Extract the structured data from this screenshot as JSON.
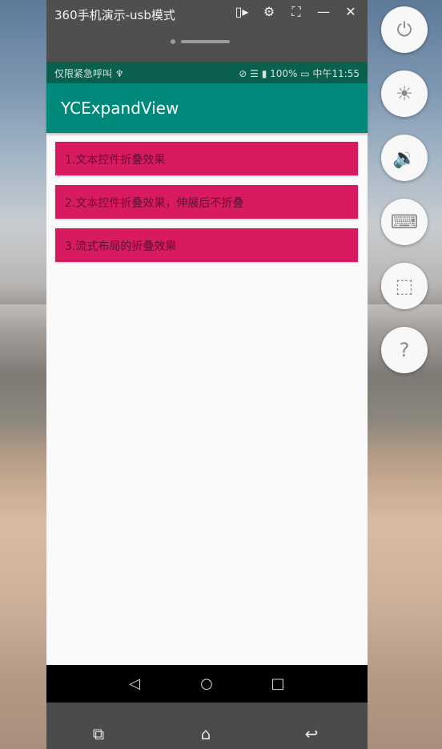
{
  "window": {
    "title": "360手机演示-usb模式",
    "title_icons": [
      {
        "icon": "screen-record-icon",
        "glyph": "▯▸"
      },
      {
        "icon": "gear-icon",
        "glyph": "⚙"
      },
      {
        "icon": "fullscreen-icon",
        "glyph": "⛶"
      },
      {
        "icon": "minimize-icon",
        "glyph": "—"
      },
      {
        "icon": "close-icon",
        "glyph": "✕"
      }
    ]
  },
  "status_bar": {
    "left_text": "仅限紧急呼叫 ♆",
    "right_text": "⊘ ☰ ▮ 100% ▭ 中午11:55"
  },
  "app_bar": {
    "title": "YCExpandView"
  },
  "list": {
    "items": [
      {
        "label": "1.文本控件折叠效果"
      },
      {
        "label": "2.文本控件折叠效果，伸展后不折叠"
      },
      {
        "label": "3.流式布局的折叠效果"
      }
    ]
  },
  "nav_bar": {
    "back_glyph": "◁",
    "home_glyph": "○",
    "recents_glyph": "□"
  },
  "bottom_bar": {
    "recents_glyph": "⧉",
    "home_glyph": "⌂",
    "back_glyph": "↩"
  },
  "side_controls": [
    {
      "icon": "power-icon",
      "glyph": "⏻"
    },
    {
      "icon": "brightness-icon",
      "glyph": "☀"
    },
    {
      "icon": "volume-icon",
      "glyph": "🔉"
    },
    {
      "icon": "keyboard-icon",
      "glyph": "⌨"
    },
    {
      "icon": "crop-icon",
      "glyph": "⬚"
    },
    {
      "icon": "help-icon",
      "glyph": "?"
    }
  ],
  "colors": {
    "status_bar": "#0b5f4f",
    "app_bar": "#00897b",
    "list_item": "#d81b60",
    "window_chrome": "#4f4f4f"
  }
}
